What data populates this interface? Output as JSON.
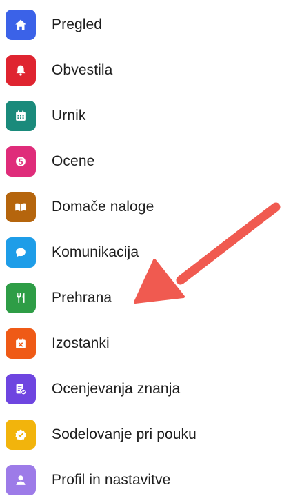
{
  "menu": {
    "items": [
      {
        "label": "Pregled",
        "icon": "home-icon",
        "color": "#3b62e8"
      },
      {
        "label": "Obvestila",
        "icon": "bell-icon",
        "color": "#df2430"
      },
      {
        "label": "Urnik",
        "icon": "calendar-icon",
        "color": "#1a8a7b"
      },
      {
        "label": "Ocene",
        "icon": "grade-icon",
        "color": "#df2c7a"
      },
      {
        "label": "Domače naloge",
        "icon": "book-icon",
        "color": "#b5650d"
      },
      {
        "label": "Komunikacija",
        "icon": "chat-bubble-icon",
        "color": "#1e9de8"
      },
      {
        "label": "Prehrana",
        "icon": "cutlery-icon",
        "color": "#2e9d46"
      },
      {
        "label": "Izostanki",
        "icon": "calendar-x-icon",
        "color": "#ef5a16"
      },
      {
        "label": "Ocenjevanja znanja",
        "icon": "document-check-icon",
        "color": "#6e45e0"
      },
      {
        "label": "Sodelovanje pri pouku",
        "icon": "badge-check-icon",
        "color": "#f2b40c"
      },
      {
        "label": "Profil in nastavitve",
        "icon": "user-icon",
        "color": "#9d7be8"
      }
    ]
  },
  "annotation": {
    "icon": "red-arrow-icon",
    "color": "#f05a50"
  }
}
